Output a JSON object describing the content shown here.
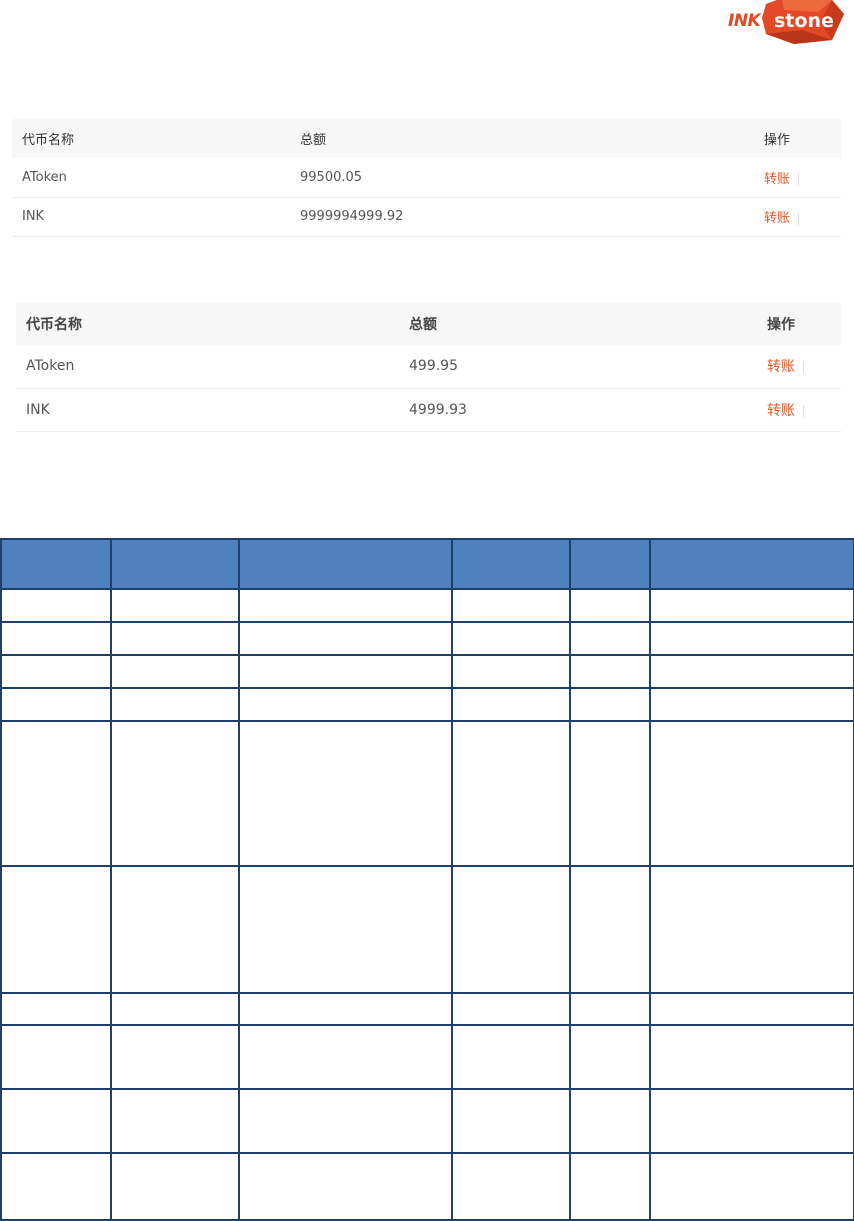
{
  "logo": {
    "text_ink": "INK",
    "text_stone": "stone",
    "brand_color": "#e34926"
  },
  "account_table": {
    "columns": [
      "代币名称",
      "总额",
      "操作"
    ],
    "rows": [
      {
        "name": "AToken",
        "amount": "99500.05",
        "action": "转账"
      },
      {
        "name": "INK",
        "amount": "9999994999.92",
        "action": "转账"
      }
    ]
  },
  "wallet_table": {
    "columns": [
      "代币名称",
      "总额",
      "操作"
    ],
    "rows": [
      {
        "name": "AToken",
        "amount": "499.95",
        "action": "转账"
      },
      {
        "name": "INK",
        "amount": "4999.93",
        "action": "转账"
      }
    ]
  },
  "colors": {
    "link": "#e05a2b",
    "grid_header": "#4e81bd",
    "grid_border": "#1f3f66"
  }
}
